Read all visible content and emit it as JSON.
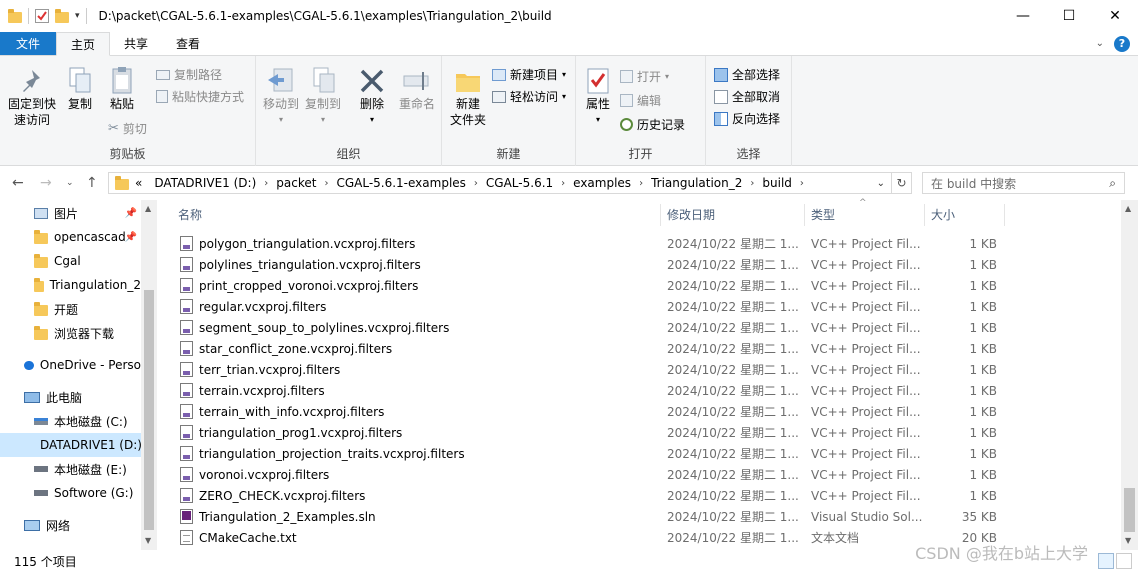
{
  "window": {
    "title_path": "D:\\packet\\CGAL-5.6.1-examples\\CGAL-5.6.1\\examples\\Triangulation_2\\build",
    "controls": {
      "minimize": "—",
      "maximize": "☐",
      "close": "✕"
    }
  },
  "ribbon_tabs": {
    "file": "文件",
    "home": "主页",
    "share": "共享",
    "view": "查看"
  },
  "ribbon": {
    "clipboard": {
      "label": "剪贴板",
      "pin": "固定到快\n速访问",
      "pin_l1": "固定到快",
      "pin_l2": "速访问",
      "copy": "复制",
      "paste": "粘贴",
      "copy_path": "复制路径",
      "paste_shortcut": "粘贴快捷方式",
      "cut": "剪切"
    },
    "organize": {
      "label": "组织",
      "move_to": "移动到",
      "copy_to": "复制到",
      "delete": "删除",
      "rename": "重命名"
    },
    "new": {
      "label": "新建",
      "new_folder_l1": "新建",
      "new_folder_l2": "文件夹",
      "new_item": "新建项目",
      "easy_access": "轻松访问"
    },
    "open": {
      "label": "打开",
      "properties": "属性",
      "open": "打开",
      "edit": "编辑",
      "history": "历史记录"
    },
    "select": {
      "label": "选择",
      "select_all": "全部选择",
      "select_none": "全部取消",
      "invert": "反向选择"
    }
  },
  "address": {
    "prefix": "«",
    "crumbs": [
      "DATADRIVE1 (D:)",
      "packet",
      "CGAL-5.6.1-examples",
      "CGAL-5.6.1",
      "examples",
      "Triangulation_2",
      "build"
    ],
    "search_placeholder": "在 build 中搜索"
  },
  "nav": [
    {
      "label": "图片",
      "pinned": true
    },
    {
      "label": "opencascad",
      "pinned": true
    },
    {
      "label": "Cgal",
      "pinned": false
    },
    {
      "label": "Triangulation_2",
      "pinned": false
    },
    {
      "label": "开题",
      "pinned": false
    },
    {
      "label": "浏览器下载",
      "pinned": false
    },
    {
      "label": "OneDrive - Perso",
      "pinned": false
    },
    {
      "label": "此电脑",
      "pinned": false
    },
    {
      "label": "本地磁盘 (C:)",
      "pinned": false
    },
    {
      "label": "DATADRIVE1 (D:)",
      "pinned": false
    },
    {
      "label": "本地磁盘 (E:)",
      "pinned": false
    },
    {
      "label": "Softwore (G:)",
      "pinned": false
    },
    {
      "label": "网络",
      "pinned": false
    }
  ],
  "columns": {
    "name": "名称",
    "date": "修改日期",
    "type": "类型",
    "size": "大小"
  },
  "files": [
    {
      "name": "polygon_triangulation.vcxproj.filters",
      "date": "2024/10/22 星期二 1...",
      "type": "VC++ Project Fil...",
      "size": "1 KB",
      "kind": "filters"
    },
    {
      "name": "polylines_triangulation.vcxproj.filters",
      "date": "2024/10/22 星期二 1...",
      "type": "VC++ Project Fil...",
      "size": "1 KB",
      "kind": "filters"
    },
    {
      "name": "print_cropped_voronoi.vcxproj.filters",
      "date": "2024/10/22 星期二 1...",
      "type": "VC++ Project Fil...",
      "size": "1 KB",
      "kind": "filters"
    },
    {
      "name": "regular.vcxproj.filters",
      "date": "2024/10/22 星期二 1...",
      "type": "VC++ Project Fil...",
      "size": "1 KB",
      "kind": "filters"
    },
    {
      "name": "segment_soup_to_polylines.vcxproj.filters",
      "date": "2024/10/22 星期二 1...",
      "type": "VC++ Project Fil...",
      "size": "1 KB",
      "kind": "filters"
    },
    {
      "name": "star_conflict_zone.vcxproj.filters",
      "date": "2024/10/22 星期二 1...",
      "type": "VC++ Project Fil...",
      "size": "1 KB",
      "kind": "filters"
    },
    {
      "name": "terr_trian.vcxproj.filters",
      "date": "2024/10/22 星期二 1...",
      "type": "VC++ Project Fil...",
      "size": "1 KB",
      "kind": "filters"
    },
    {
      "name": "terrain.vcxproj.filters",
      "date": "2024/10/22 星期二 1...",
      "type": "VC++ Project Fil...",
      "size": "1 KB",
      "kind": "filters"
    },
    {
      "name": "terrain_with_info.vcxproj.filters",
      "date": "2024/10/22 星期二 1...",
      "type": "VC++ Project Fil...",
      "size": "1 KB",
      "kind": "filters"
    },
    {
      "name": "triangulation_prog1.vcxproj.filters",
      "date": "2024/10/22 星期二 1...",
      "type": "VC++ Project Fil...",
      "size": "1 KB",
      "kind": "filters"
    },
    {
      "name": "triangulation_projection_traits.vcxproj.filters",
      "date": "2024/10/22 星期二 1...",
      "type": "VC++ Project Fil...",
      "size": "1 KB",
      "kind": "filters"
    },
    {
      "name": "voronoi.vcxproj.filters",
      "date": "2024/10/22 星期二 1...",
      "type": "VC++ Project Fil...",
      "size": "1 KB",
      "kind": "filters"
    },
    {
      "name": "ZERO_CHECK.vcxproj.filters",
      "date": "2024/10/22 星期二 1...",
      "type": "VC++ Project Fil...",
      "size": "1 KB",
      "kind": "filters"
    },
    {
      "name": "Triangulation_2_Examples.sln",
      "date": "2024/10/22 星期二 1...",
      "type": "Visual Studio Sol...",
      "size": "35 KB",
      "kind": "sln"
    },
    {
      "name": "CMakeCache.txt",
      "date": "2024/10/22 星期二 1...",
      "type": "文本文档",
      "size": "20 KB",
      "kind": "txt"
    }
  ],
  "status": {
    "count": "115 个项目"
  },
  "watermark": "CSDN @我在b站上大学",
  "colors": {
    "accent": "#1979ca",
    "selected": "#cce8ff",
    "folder": "#f6c85a"
  }
}
